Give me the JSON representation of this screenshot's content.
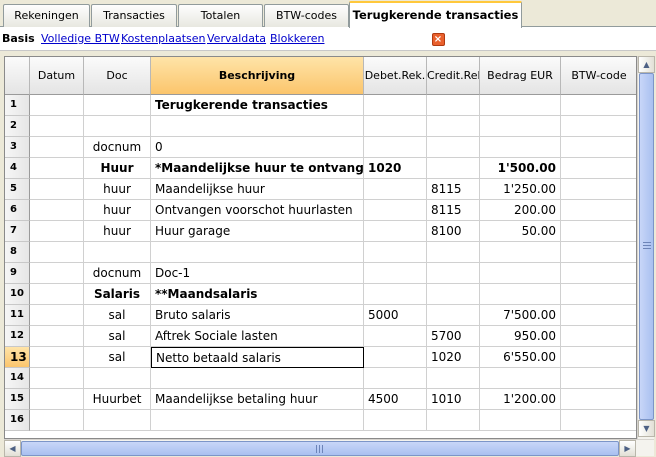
{
  "tabs": [
    {
      "label": "Rekeningen",
      "active": false
    },
    {
      "label": "Transacties",
      "active": false
    },
    {
      "label": "Totalen",
      "active": false
    },
    {
      "label": "BTW-codes",
      "active": false
    },
    {
      "label": "Terugkerende transacties",
      "active": true
    }
  ],
  "close_glyph": "×",
  "views": [
    {
      "label": "Basis",
      "current": true
    },
    {
      "label": "Volledige BTW",
      "current": false
    },
    {
      "label": "Kostenplaatsen",
      "current": false
    },
    {
      "label": "Vervaldata",
      "current": false
    },
    {
      "label": "Blokkeren",
      "current": false
    }
  ],
  "columns": [
    "Datum",
    "Doc",
    "Beschrijving",
    "Debet.Rek.",
    "Credit.Rek",
    "Bedrag EUR",
    "BTW-code"
  ],
  "selected_column": 2,
  "rows": [
    {
      "n": "1",
      "datum": "",
      "doc": "",
      "beschrijving": "Terugkerende transacties",
      "debet": "",
      "credit": "",
      "bedrag": "",
      "btw": "",
      "bold": true
    },
    {
      "n": "2",
      "datum": "",
      "doc": "",
      "beschrijving": "",
      "debet": "",
      "credit": "",
      "bedrag": "",
      "btw": "",
      "bold": false
    },
    {
      "n": "3",
      "datum": "",
      "doc": "docnum",
      "beschrijving": "0",
      "debet": "",
      "credit": "",
      "bedrag": "",
      "btw": "",
      "bold": false
    },
    {
      "n": "4",
      "datum": "",
      "doc": "Huur",
      "beschrijving": "*Maandelijkse huur te ontvangen",
      "debet": "1020",
      "credit": "",
      "bedrag": "1'500.00",
      "btw": "",
      "bold": true
    },
    {
      "n": "5",
      "datum": "",
      "doc": "huur",
      "beschrijving": "Maandelijkse huur",
      "debet": "",
      "credit": "8115",
      "bedrag": "1'250.00",
      "btw": "",
      "bold": false
    },
    {
      "n": "6",
      "datum": "",
      "doc": "huur",
      "beschrijving": "Ontvangen voorschot huurlasten",
      "debet": "",
      "credit": "8115",
      "bedrag": "200.00",
      "btw": "",
      "bold": false
    },
    {
      "n": "7",
      "datum": "",
      "doc": "huur",
      "beschrijving": "Huur garage",
      "debet": "",
      "credit": "8100",
      "bedrag": "50.00",
      "btw": "",
      "bold": false
    },
    {
      "n": "8",
      "datum": "",
      "doc": "",
      "beschrijving": "",
      "debet": "",
      "credit": "",
      "bedrag": "",
      "btw": "",
      "bold": false
    },
    {
      "n": "9",
      "datum": "",
      "doc": "docnum",
      "beschrijving": "Doc-1",
      "debet": "",
      "credit": "",
      "bedrag": "",
      "btw": "",
      "bold": false
    },
    {
      "n": "10",
      "datum": "",
      "doc": "Salaris",
      "beschrijving": "**Maandsalaris",
      "debet": "",
      "credit": "",
      "bedrag": "",
      "btw": "",
      "bold": true
    },
    {
      "n": "11",
      "datum": "",
      "doc": "sal",
      "beschrijving": "Bruto salaris",
      "debet": "5000",
      "credit": "",
      "bedrag": "7'500.00",
      "btw": "",
      "bold": false
    },
    {
      "n": "12",
      "datum": "",
      "doc": "sal",
      "beschrijving": "Aftrek Sociale lasten",
      "debet": "",
      "credit": "5700",
      "bedrag": "950.00",
      "btw": "",
      "bold": false
    },
    {
      "n": "13",
      "datum": "",
      "doc": "sal",
      "beschrijving": "Netto betaald salaris",
      "debet": "",
      "credit": "1020",
      "bedrag": "6'550.00",
      "btw": "",
      "bold": false
    },
    {
      "n": "14",
      "datum": "",
      "doc": "",
      "beschrijving": "",
      "debet": "",
      "credit": "",
      "bedrag": "",
      "btw": "",
      "bold": false
    },
    {
      "n": "15",
      "datum": "",
      "doc": "Huurbet",
      "beschrijving": "Maandelijkse betaling huur",
      "debet": "4500",
      "credit": "1010",
      "bedrag": "1'200.00",
      "btw": "",
      "bold": false
    },
    {
      "n": "16",
      "datum": "",
      "doc": "",
      "beschrijving": "",
      "debet": "",
      "credit": "",
      "bedrag": "",
      "btw": "",
      "bold": false
    }
  ],
  "current_row": 12,
  "scroll_up": "▲",
  "scroll_down": "▼",
  "scroll_left": "◀",
  "scroll_right": "▶"
}
